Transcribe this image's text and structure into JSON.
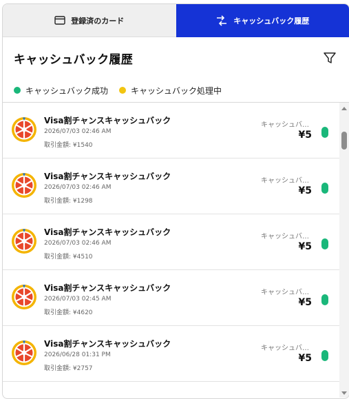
{
  "tabs": [
    {
      "label": "登録済のカード",
      "icon": "card-icon",
      "active": false
    },
    {
      "label": "キャッシュバック履歴",
      "icon": "exchange-icon",
      "active": true
    }
  ],
  "header": {
    "title": "キャッシュバック履歴",
    "filter_icon": "filter-icon"
  },
  "legend": [
    {
      "label": "キャッシュバック成功",
      "color": "#1ab77a"
    },
    {
      "label": "キャッシュバック処理中",
      "color": "#f2c511"
    }
  ],
  "colors": {
    "accent": "#1533d6",
    "success": "#1ab77a",
    "pending": "#f2c511"
  },
  "transactions": [
    {
      "name": "Visa割チャンスキャッシュバック",
      "date": "2026/07/03 02:46 AM",
      "amount": "取引金額: ¥1540",
      "status_text": "キャッシュバック成功",
      "reward": "¥5"
    },
    {
      "name": "Visa割チャンスキャッシュバック",
      "date": "2026/07/03 02:46 AM",
      "amount": "取引金額: ¥1298",
      "status_text": "キャッシュバック成功",
      "reward": "¥5"
    },
    {
      "name": "Visa割チャンスキャッシュバック",
      "date": "2026/07/03 02:46 AM",
      "amount": "取引金額: ¥4510",
      "status_text": "キャッシュバック成功",
      "reward": "¥5"
    },
    {
      "name": "Visa割チャンスキャッシュバック",
      "date": "2026/07/03 02:45 AM",
      "amount": "取引金額: ¥4620",
      "status_text": "キャッシュバック成功",
      "reward": "¥5"
    },
    {
      "name": "Visa割チャンスキャッシュバック",
      "date": "2026/06/28 01:31 PM",
      "amount": "取引金額: ¥2757",
      "status_text": "キャッシュバック成功",
      "reward": "¥5"
    }
  ]
}
